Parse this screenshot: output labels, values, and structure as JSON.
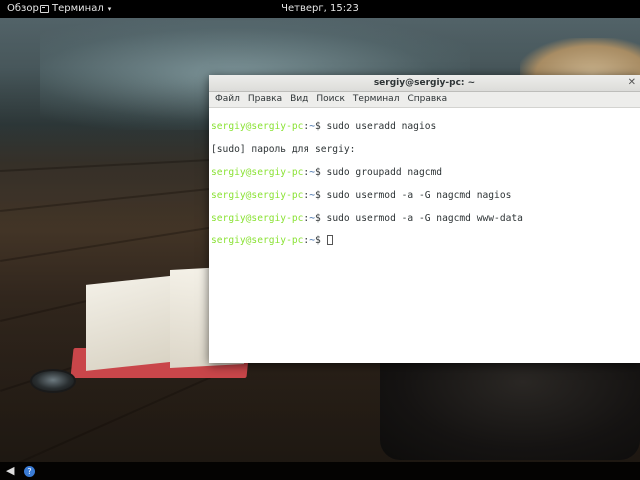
{
  "topbar": {
    "activities_label": "Обзор",
    "app_menu_label": "Терминал",
    "clock": "Четверг, 15:23"
  },
  "window": {
    "title": "sergiy@sergiy-pc: ~",
    "menu": [
      "Файл",
      "Правка",
      "Вид",
      "Поиск",
      "Терминал",
      "Справка"
    ]
  },
  "terminal": {
    "lines": [
      {
        "type": "prompt",
        "user": "sergiy@sergiy-pc",
        "path": "~",
        "command": "sudo useradd nagios"
      },
      {
        "type": "text",
        "text": "[sudo] пароль для sergiy:"
      },
      {
        "type": "prompt",
        "user": "sergiy@sergiy-pc",
        "path": "~",
        "command": "sudo groupadd nagcmd"
      },
      {
        "type": "prompt",
        "user": "sergiy@sergiy-pc",
        "path": "~",
        "command": "sudo usermod -a -G nagcmd nagios"
      },
      {
        "type": "prompt",
        "user": "sergiy@sergiy-pc",
        "path": "~",
        "command": "sudo usermod -a -G nagcmd www-data"
      },
      {
        "type": "prompt",
        "user": "sergiy@sergiy-pc",
        "path": "~",
        "command": ""
      }
    ]
  },
  "colors": {
    "prompt_user": "#8ae234",
    "prompt_path": "#3465a4",
    "topbar_bg": "#000000"
  }
}
